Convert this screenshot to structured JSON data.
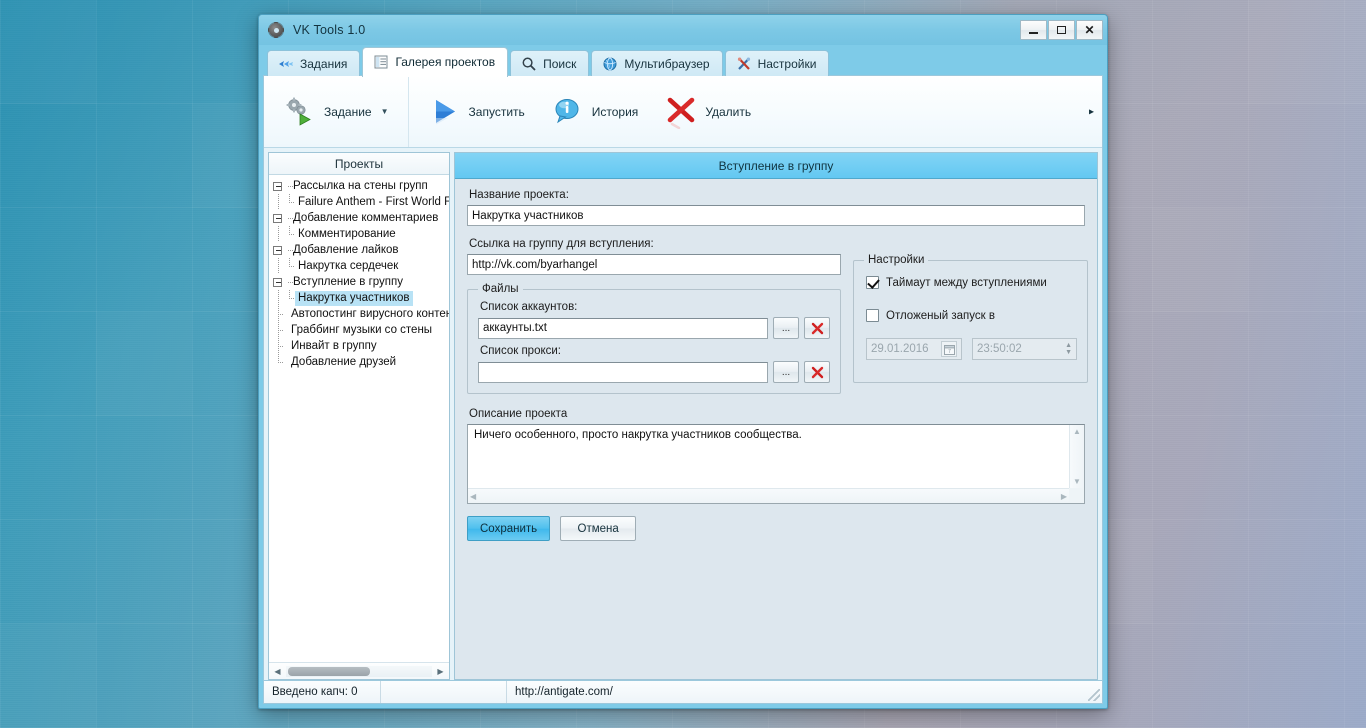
{
  "window": {
    "title": "VK Tools  1.0",
    "app_icon": "gear-icon",
    "controls": {
      "minimize": "_",
      "maximize": "❐",
      "close": "✕"
    }
  },
  "tabs": [
    {
      "label": "Задания",
      "icon": "arrows-icon",
      "active": false
    },
    {
      "label": "Галерея проектов",
      "icon": "list-document-icon",
      "active": true
    },
    {
      "label": "Поиск",
      "icon": "magnifier-icon",
      "active": false
    },
    {
      "label": "Мультибраузер",
      "icon": "globe-icon",
      "active": false
    },
    {
      "label": "Настройки",
      "icon": "tools-icon",
      "active": false
    }
  ],
  "toolbar": {
    "groups": [
      {
        "items": [
          {
            "label": "Задание",
            "icon": "gears-play-icon",
            "has_dropdown": true
          }
        ]
      },
      {
        "items": [
          {
            "label": "Запустить",
            "icon": "play-triangle-icon",
            "has_dropdown": false
          },
          {
            "label": "История",
            "icon": "info-bubble-icon",
            "has_dropdown": false
          },
          {
            "label": "Удалить",
            "icon": "red-cross-icon",
            "has_dropdown": false
          }
        ]
      }
    ],
    "overflow_glyph": "▸"
  },
  "projects_panel": {
    "header": "Проекты",
    "tree": [
      {
        "label": "Рассылка на стены групп",
        "level": 0,
        "expander": true,
        "selected": false
      },
      {
        "label": "Failure Anthem - First World F",
        "level": 1,
        "expander": false,
        "selected": false
      },
      {
        "label": "Добавление комментариев",
        "level": 0,
        "expander": true,
        "selected": false
      },
      {
        "label": "Комментирование",
        "level": 1,
        "expander": false,
        "selected": false
      },
      {
        "label": "Добавление лайков",
        "level": 0,
        "expander": true,
        "selected": false
      },
      {
        "label": "Накрутка сердечек",
        "level": 1,
        "expander": false,
        "selected": false
      },
      {
        "label": "Вступление в группу",
        "level": 0,
        "expander": true,
        "selected": false
      },
      {
        "label": "Накрутка участников",
        "level": 1,
        "expander": false,
        "selected": true
      },
      {
        "label": "Автопостинг вирусного контен",
        "level": 0,
        "expander": false,
        "selected": false
      },
      {
        "label": "Граббинг музыки со стены",
        "level": 0,
        "expander": false,
        "selected": false
      },
      {
        "label": "Инвайт в группу",
        "level": 0,
        "expander": false,
        "selected": false
      },
      {
        "label": "Добавление друзей",
        "level": 0,
        "expander": false,
        "selected": false
      }
    ],
    "hscroll": {
      "left_arrow": "◀",
      "right_arrow": "▶"
    }
  },
  "form": {
    "title": "Вступление в группу",
    "project_name_label": "Название проекта:",
    "project_name_value": "Накрутка участников",
    "group_link_label": "Ссылка на группу для вступления:",
    "group_link_value": "http://vk.com/byarhangel",
    "files_group": {
      "legend": "Файлы",
      "accounts_label": "Список аккаунтов:",
      "accounts_value": "аккаунты.txt",
      "accounts_placeholder": "",
      "proxy_label": "Список прокси:",
      "proxy_value": "",
      "proxy_placeholder": "",
      "browse_label": "...",
      "clear_label": "✘"
    },
    "settings_group": {
      "legend": "Настройки",
      "timeout_label": "Таймаут между вступлениями",
      "timeout_checked": true,
      "delayed_label": "Отложеный запуск в",
      "delayed_checked": false,
      "date_value": "29.01.2016",
      "time_value": "23:50:02",
      "calendar_icon": "calendar-icon",
      "spinner_up": "▲",
      "spinner_down": "▼"
    },
    "description_label": "Описание проекта",
    "description_value": "Ничего особенного, просто накрутка участников сообщества.",
    "save_label": "Сохранить",
    "cancel_label": "Отмена"
  },
  "statusbar": {
    "captcha_text": "Введено капч: 0",
    "middle_text": "",
    "link_text": "http://antigate.com/"
  },
  "colors": {
    "window_frame": "#7ecbe8",
    "title_bar": "#82cce8",
    "form_header": "#63c8f2",
    "accent_button": "#4fc0ee",
    "selection": "#b8e2f5",
    "delete_red": "#cf1f1f"
  }
}
